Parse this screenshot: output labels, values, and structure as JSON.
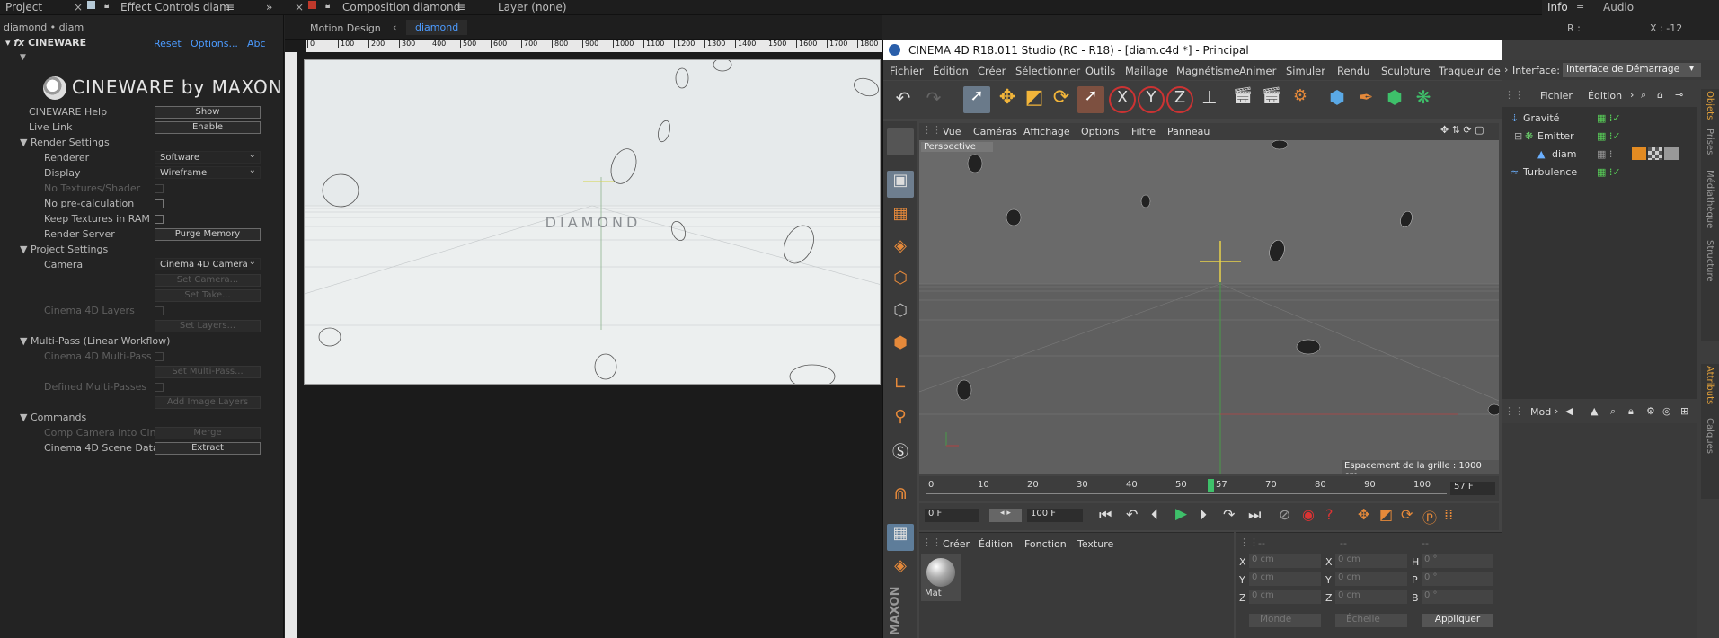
{
  "top_bar": {
    "project": "Project",
    "effect_controls": "Effect Controls",
    "effect_controls_layer": "diam",
    "composition": "Composition",
    "composition_name": "diamond",
    "layer": "Layer (none)",
    "info": "Info",
    "audio": "Audio",
    "info_r": "R :",
    "info_x": "X : -12"
  },
  "effect_controls": {
    "breadcrumb": "diamond • diam",
    "effect_name": "CINEWARE",
    "reset": "Reset",
    "options": "Options...",
    "abc": "Abc",
    "logo": "CINEWARE by MAXON",
    "help_label": "CINEWARE Help",
    "help_button": "Show",
    "live_link_label": "Live Link",
    "live_link_button": "Enable",
    "render_settings": "Render Settings",
    "renderer_label": "Renderer",
    "renderer_value": "Software",
    "display_label": "Display",
    "display_value": "Wireframe",
    "no_textures": "No Textures/Shader",
    "no_precalc": "No pre-calculation",
    "keep_textures": "Keep Textures in RAM",
    "render_server": "Render Server",
    "purge_memory": "Purge Memory",
    "project_settings": "Project Settings",
    "camera_label": "Camera",
    "camera_value": "Cinema 4D Camera",
    "set_camera": "Set Camera...",
    "set_take": "Set Take...",
    "c4d_layers": "Cinema 4D Layers",
    "set_layers": "Set Layers...",
    "multipass": "Multi-Pass (Linear Workflow)",
    "c4d_multipass": "Cinema 4D Multi-Pass",
    "set_multipass": "Set Multi-Pass...",
    "defined_multipasses": "Defined Multi-Passes",
    "add_image_layers": "Add Image Layers",
    "commands": "Commands",
    "comp_camera": "Comp Camera into Cin",
    "merge": "Merge",
    "scene_data": "Cinema 4D Scene Data",
    "extract": "Extract"
  },
  "composition": {
    "tab_motion_design": "Motion Design",
    "tab_diamond": "diamond",
    "ruler_ticks": [
      "0",
      "100",
      "200",
      "300",
      "400",
      "500",
      "600",
      "700",
      "800",
      "900",
      "1000",
      "1100",
      "1200",
      "1300",
      "1400",
      "1500",
      "1600",
      "1700",
      "1800"
    ],
    "text": "DIAMOND"
  },
  "c4d": {
    "title": "CINEMA 4D R18.011 Studio (RC - R18) - [diam.c4d *] - Principal",
    "menu": [
      "Fichier",
      "Édition",
      "Créer",
      "Sélectionner",
      "Outils",
      "Maillage",
      "Magnétisme",
      "Animer",
      "Simuler",
      "Rendu",
      "Sculpture",
      "Traqueur de"
    ],
    "interface_label": "Interface:",
    "interface_value": "Interface de Démarrage",
    "view_menu": [
      "Vue",
      "Caméras",
      "Affichage",
      "Options",
      "Filtre",
      "Panneau"
    ],
    "viewport_label": "Perspective",
    "grid_spacing": "Espacement de la grille : 1000 cm",
    "timeline_ticks": [
      "0",
      "10",
      "20",
      "30",
      "40",
      "50",
      "57",
      "70",
      "80",
      "90",
      "100"
    ],
    "current_frame": "57 F",
    "start_frame": "0 F",
    "end_frame": "100 F",
    "material_menu": [
      "Créer",
      "Édition",
      "Fonction",
      "Texture"
    ],
    "material_name": "Mat",
    "coords": {
      "header": [
        "--",
        "--",
        "--"
      ],
      "rows": [
        {
          "a": "X",
          "av": "0 cm",
          "b": "X",
          "bv": "0 cm",
          "c": "H",
          "cv": "0 °"
        },
        {
          "a": "Y",
          "av": "0 cm",
          "b": "Y",
          "bv": "0 cm",
          "c": "P",
          "cv": "0 °"
        },
        {
          "a": "Z",
          "av": "0 cm",
          "b": "Z",
          "bv": "0 cm",
          "c": "B",
          "cv": "0 °"
        }
      ],
      "space": "Monde",
      "scale": "Échelle",
      "apply": "Appliquer"
    },
    "objects_menu": [
      "Fichier",
      "Édition"
    ],
    "objects": [
      "Gravité",
      "Emitter",
      "diam",
      "Turbulence"
    ],
    "attributes_menu": "Mod",
    "side_tabs": [
      "Objets",
      "Prises",
      "Médiathèque",
      "Structure"
    ],
    "side_tabs2": [
      "Attributs",
      "Calques"
    ]
  }
}
